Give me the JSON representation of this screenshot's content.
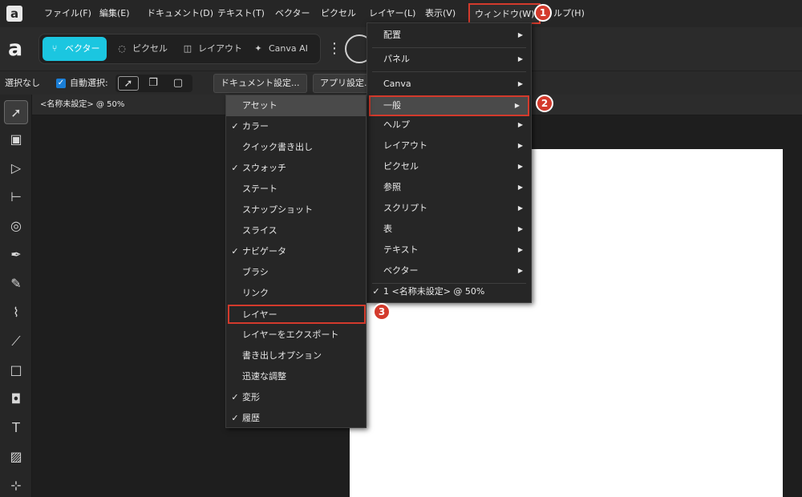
{
  "menubar": {
    "logo": "a",
    "items": [
      "ファイル(F)",
      "編集(E)",
      "ドキュメント(D)",
      "テキスト(T)",
      "ベクター",
      "ピクセル",
      "レイヤー(L)",
      "表示(V)",
      "ウィンドウ(W)",
      "ヘルプ(H)"
    ],
    "help_partial": "ルプ(H)"
  },
  "toolbar": {
    "logo": "a",
    "personas": [
      {
        "label": "ベクター",
        "icon": "vector-persona-icon",
        "active": true
      },
      {
        "label": "ピクセル",
        "icon": "pixel-persona-icon",
        "active": false
      },
      {
        "label": "レイアウト",
        "icon": "layout-persona-icon",
        "active": false
      },
      {
        "label": "Canva AI",
        "icon": "sparkle-icon",
        "active": false
      }
    ]
  },
  "contextbar": {
    "selection": "選択なし",
    "auto_select": "自動選択:",
    "document_settings": "ドキュメント設定...",
    "app_settings": "アプリ設定..."
  },
  "document": {
    "tab_title": "<名称未設定> @ 50%"
  },
  "window_menu": {
    "items": [
      {
        "label": "配置",
        "submenu": true
      },
      {
        "label": "パネル",
        "submenu": true
      },
      {
        "label": "Canva",
        "submenu": true
      },
      {
        "label": "一般",
        "submenu": true
      },
      {
        "label": "ヘルプ",
        "submenu": true
      },
      {
        "label": "レイアウト",
        "submenu": true
      },
      {
        "label": "ピクセル",
        "submenu": true
      },
      {
        "label": "参照",
        "submenu": true
      },
      {
        "label": "スクリプト",
        "submenu": true
      },
      {
        "label": "表",
        "submenu": true
      },
      {
        "label": "テキスト",
        "submenu": true
      },
      {
        "label": "ベクター",
        "submenu": true
      },
      {
        "label": "1 <名称未設定> @ 50%",
        "submenu": false,
        "checked": true
      }
    ]
  },
  "general_submenu": {
    "items": [
      {
        "label": "アセット",
        "checked": false
      },
      {
        "label": "カラー",
        "checked": true
      },
      {
        "label": "クイック書き出し",
        "checked": false
      },
      {
        "label": "スウォッチ",
        "checked": true
      },
      {
        "label": "ステート",
        "checked": false
      },
      {
        "label": "スナップショット",
        "checked": false
      },
      {
        "label": "スライス",
        "checked": false
      },
      {
        "label": "ナビゲータ",
        "checked": true
      },
      {
        "label": "ブラシ",
        "checked": false
      },
      {
        "label": "リンク",
        "checked": false
      },
      {
        "label": "レイヤー",
        "checked": false
      },
      {
        "label": "レイヤーをエクスポート",
        "checked": false
      },
      {
        "label": "書き出しオプション",
        "checked": false
      },
      {
        "label": "迅速な調整",
        "checked": false
      },
      {
        "label": "変形",
        "checked": true
      },
      {
        "label": "履歴",
        "checked": true
      }
    ]
  },
  "glyphs": {
    "check": "✓",
    "arrow": "▶"
  },
  "badges": [
    "1",
    "2",
    "3"
  ],
  "colors": {
    "accent": "#1bc6e0",
    "highlight": "#d33a2c"
  }
}
